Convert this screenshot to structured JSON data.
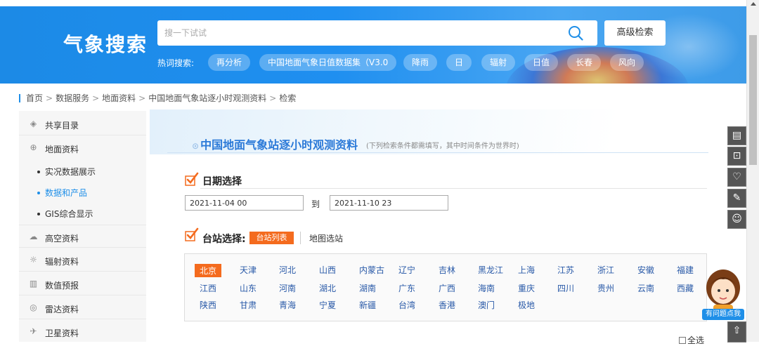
{
  "header": {
    "logo_text": "气象搜索",
    "search_placeholder": "搜一下试试",
    "advanced_search": "高级检索",
    "hot_label": "热词搜索:",
    "hot_tags": [
      "再分析",
      "中国地面气象日值数据集（V3.0",
      "降雨",
      "日",
      "辐射",
      "日值",
      "长春",
      "风向"
    ]
  },
  "breadcrumb": [
    "首页",
    "数据服务",
    "地面资料",
    "中国地面气象站逐小时观测资料",
    "检索"
  ],
  "sidebar": {
    "items": [
      {
        "label": "共享目录",
        "icon": "cube-icon"
      },
      {
        "label": "地面资料",
        "icon": "globe-icon"
      },
      {
        "label": "高空资料",
        "icon": "cloud-icon"
      },
      {
        "label": "辐射资料",
        "icon": "radiation-icon"
      },
      {
        "label": "数值预报",
        "icon": "bar-chart-icon"
      },
      {
        "label": "雷达资料",
        "icon": "radar-icon"
      },
      {
        "label": "卫星资料",
        "icon": "satellite-icon"
      }
    ],
    "subitems": [
      {
        "label": "实况数据展示",
        "active": false
      },
      {
        "label": "数据和产品",
        "active": true
      },
      {
        "label": "GIS综合显示",
        "active": false
      }
    ]
  },
  "main": {
    "title": "中国地面气象站逐小时观测资料",
    "note": "(下列检索条件都需填写，其中时间条件为世界时)",
    "date_section": "日期选择",
    "date_from": "2021-11-04 00",
    "date_to_label": "到",
    "date_to": "2021-11-10 23",
    "station_section": "台站选择:",
    "tab_list": "台站列表",
    "tab_map": "地图选站",
    "provinces": [
      [
        "北京",
        "天津",
        "河北",
        "山西",
        "内蒙古",
        "辽宁",
        "吉林",
        "黑龙江",
        "上海",
        "江苏",
        "浙江",
        "安徽",
        "福建"
      ],
      [
        "江西",
        "山东",
        "河南",
        "湖北",
        "湖南",
        "广东",
        "广西",
        "海南",
        "重庆",
        "四川",
        "贵州",
        "云南",
        "西藏"
      ],
      [
        "陕西",
        "甘肃",
        "青海",
        "宁夏",
        "新疆",
        "台湾",
        "香港",
        "澳门",
        "极地"
      ]
    ],
    "select_all": "全选"
  },
  "helper": {
    "label": "有问题点我"
  },
  "colors": {
    "accent": "#1f8fe8",
    "orange": "#f46b1e",
    "link": "#2a5aa8"
  }
}
